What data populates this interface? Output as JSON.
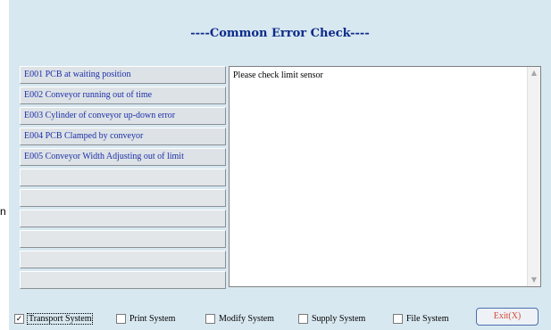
{
  "title": "----Common Error Check----",
  "errors": [
    "E001 PCB at waiting position",
    "E002 Conveyor running out of time",
    "E003 Cylinder of conveyor up-down error",
    "E004 PCB Clamped  by conveyor",
    "E005 Conveyor Width Adjusting out of limit",
    "",
    "",
    "",
    "",
    "",
    ""
  ],
  "message": "Please check limit sensor",
  "scroll": {
    "up_icon": "scroll-up-arrow",
    "down_icon": "scroll-down-arrow"
  },
  "systems": [
    {
      "label": "Transport System",
      "checked": true
    },
    {
      "label": "Print System",
      "checked": false
    },
    {
      "label": "Modify System",
      "checked": false
    },
    {
      "label": "Supply System",
      "checked": false
    },
    {
      "label": "File System",
      "checked": false
    }
  ],
  "exit_label": "Exit(X)",
  "edge_text": "n",
  "colors": {
    "panel": "#d8e8f0",
    "title": "#0d2a8a",
    "button_text": "#1c2fa8",
    "exit_text": "#d24a3a"
  }
}
